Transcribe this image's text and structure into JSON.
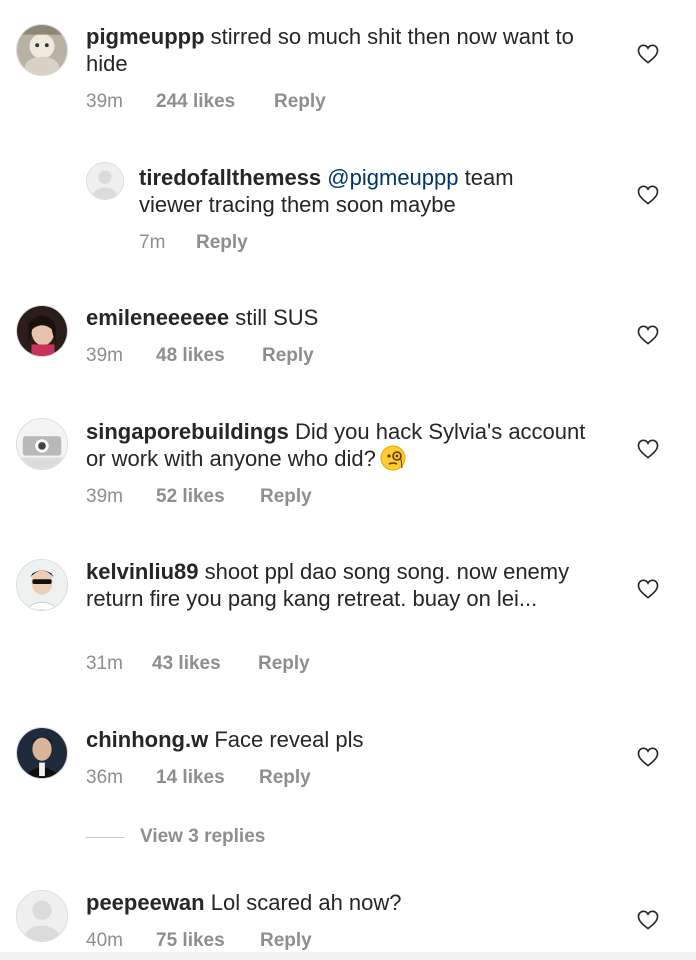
{
  "comments": [
    {
      "username": "pigmeuppp",
      "text": "stirred so much shit then now want to hide",
      "time": "39m",
      "likes": "244 likes",
      "reply": "Reply"
    },
    {
      "username": "tiredofallthemess",
      "mention": "@pigmeuppp",
      "text": "team viewer tracing them soon maybe",
      "time": "7m",
      "reply": "Reply"
    },
    {
      "username": "emileneeeeee",
      "text": "still SUS",
      "time": "39m",
      "likes": "48 likes",
      "reply": "Reply"
    },
    {
      "username": "singaporebuildings",
      "text": "Did you hack Sylvia's account or work with anyone who did?",
      "emoji": "monocle-face-emoji",
      "time": "39m",
      "likes": "52 likes",
      "reply": "Reply"
    },
    {
      "username": "kelvinliu89",
      "text": "shoot ppl dao song song. now enemy return fire you pang kang retreat. buay on lei...",
      "time": "31m",
      "likes": "43 likes",
      "reply": "Reply"
    },
    {
      "username": "chinhong.w",
      "text": "Face reveal pls",
      "time": "36m",
      "likes": "14 likes",
      "reply": "Reply"
    },
    {
      "username": "peepeewan",
      "text": "Lol scared ah now?",
      "time": "40m",
      "likes": "75 likes",
      "reply": "Reply"
    }
  ],
  "view_replies": "View 3 replies",
  "icons": {
    "like": "heart-icon",
    "default_avatar": "default-avatar-icon"
  },
  "colors": {
    "text": "#262626",
    "secondary": "#8e8e8e",
    "mention": "#00376b"
  }
}
